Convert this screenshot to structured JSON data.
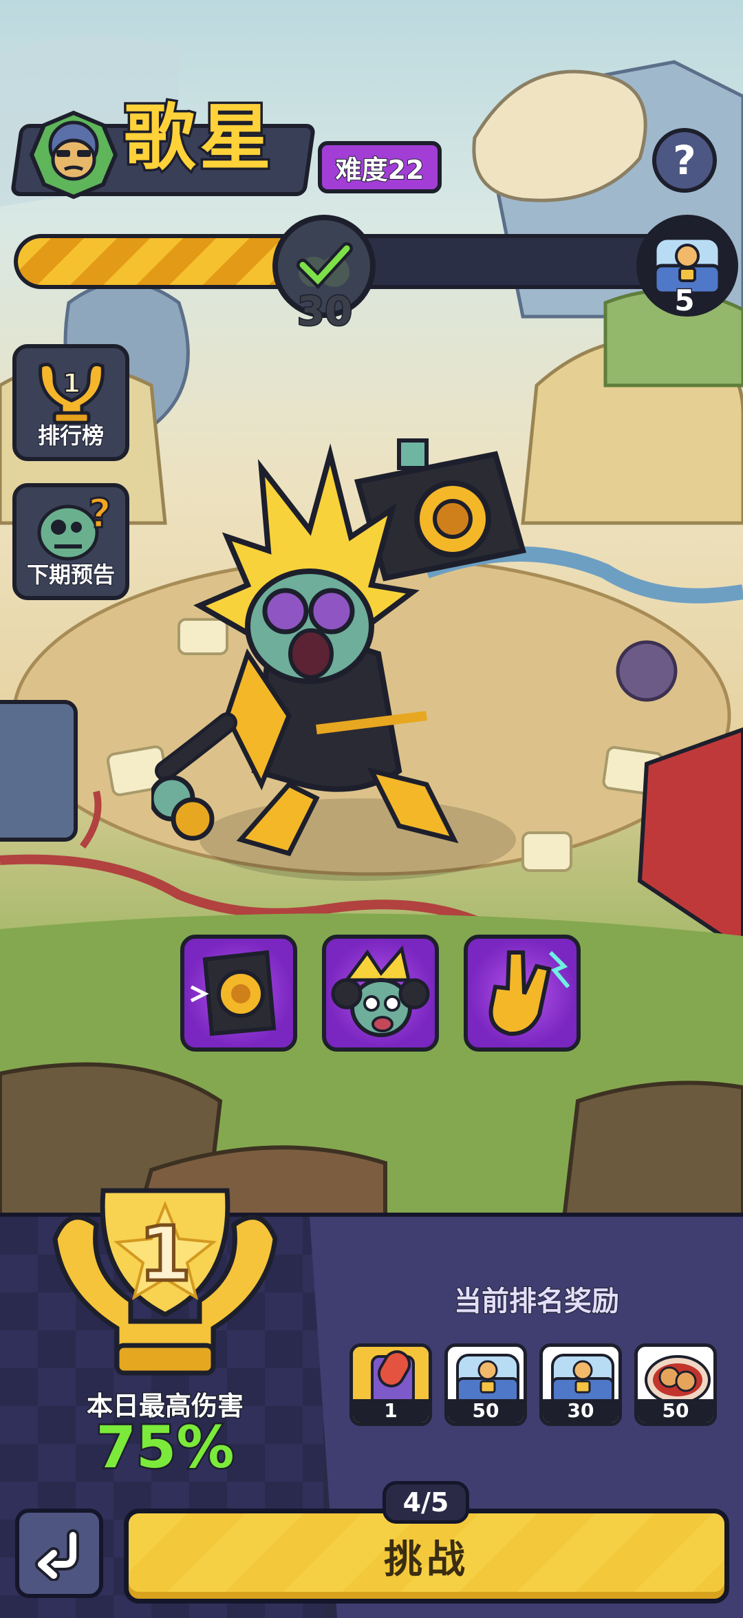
{
  "header": {
    "boss_name": "歌星",
    "difficulty": "难度22"
  },
  "progress": {
    "fraction": 0.5,
    "checkpoint": "30",
    "chest_count": "5"
  },
  "side_menu": {
    "leaderboard_label": "排行榜",
    "leaderboard_rank": "1",
    "preview_label": "下期预告"
  },
  "skills": [
    "boombox-skill-icon",
    "singer-zombie-skill-icon",
    "rock-hand-skill-icon"
  ],
  "stats": {
    "rank": "1",
    "damage_label": "本日最高伤害",
    "damage_value": "75%"
  },
  "rewards": {
    "title": "当前排名奖励",
    "items": [
      {
        "icon": "capsule-pack-icon",
        "qty": "1"
      },
      {
        "icon": "chest-icon",
        "qty": "50"
      },
      {
        "icon": "chest-icon",
        "qty": "30"
      },
      {
        "icon": "cookie-plate-icon",
        "qty": "50"
      }
    ]
  },
  "footer": {
    "attempts": "4/5",
    "challenge_label": "挑战"
  },
  "colors": {
    "accent_yellow": "#f6c12e",
    "difficulty_purple": "#a23ed6",
    "damage_green": "#7bea3a",
    "panel_dark": "#2a2a47"
  }
}
